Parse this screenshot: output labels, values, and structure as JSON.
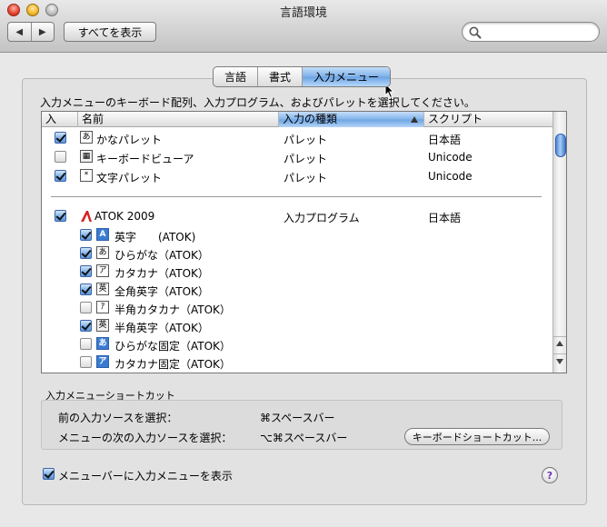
{
  "window": {
    "title": "言語環境"
  },
  "toolbar": {
    "back": "◀",
    "forward": "▶",
    "show_all": "すべてを表示",
    "search_value": "",
    "search_placeholder": ""
  },
  "tabs": [
    {
      "label": "言語",
      "active": false
    },
    {
      "label": "書式",
      "active": false
    },
    {
      "label": "入力メニュー",
      "active": true
    }
  ],
  "description": "入力メニューのキーボード配列、入力プログラム、およびパレットを選択してください。",
  "columns": {
    "enabled": "入",
    "name": "名前",
    "kind": "入力の種類",
    "script": "スクリプト",
    "sorted_column": "kind"
  },
  "rows": [
    {
      "checked": true,
      "icon_glyph": "あ",
      "icon": "kana-palette-icon",
      "name": "かなパレット",
      "kind": "パレット",
      "script": "日本語"
    },
    {
      "checked": false,
      "icon_glyph": "▦",
      "icon": "keyboard-viewer-icon",
      "name": "キーボードビューア",
      "kind": "パレット",
      "script": "Unicode"
    },
    {
      "checked": true,
      "icon_glyph": "*",
      "icon": "character-palette-icon",
      "name": "文字パレット",
      "kind": "パレット",
      "script": "Unicode"
    },
    {
      "checked": true,
      "icon_glyph": "",
      "icon": "atok-logo-icon",
      "name": "ATOK 2009",
      "kind": "入力プログラム",
      "script": "日本語"
    }
  ],
  "subrows": [
    {
      "checked": true,
      "icon_glyph": "A",
      "icon_style": "blue",
      "name": "英字　　(ATOK)"
    },
    {
      "checked": true,
      "icon_glyph": "あ",
      "icon_style": "white",
      "name": "ひらがな（ATOK）"
    },
    {
      "checked": true,
      "icon_glyph": "ア",
      "icon_style": "white",
      "name": "カタカナ（ATOK）"
    },
    {
      "checked": true,
      "icon_glyph": "英",
      "icon_style": "white",
      "name": "全角英字（ATOK）"
    },
    {
      "checked": false,
      "icon_glyph": "ｱ",
      "icon_style": "white",
      "name": "半角カタカナ（ATOK）"
    },
    {
      "checked": true,
      "icon_glyph": "英",
      "icon_style": "gray",
      "name": "半角英字（ATOK）"
    },
    {
      "checked": false,
      "icon_glyph": "あ",
      "icon_style": "blue",
      "name": "ひらがな固定（ATOK）"
    },
    {
      "checked": false,
      "icon_glyph": "ア",
      "icon_style": "blue",
      "name": "カタカナ固定（ATOK）"
    }
  ],
  "shortcuts": {
    "title": "入力メニューショートカット",
    "prev_label": "前の入力ソースを選択：",
    "prev_value": "⌘スペースバー",
    "next_label": "メニューの次の入力ソースを選択：",
    "next_value": "⌥⌘スペースバー",
    "button": "キーボードショートカット..."
  },
  "show_in_menubar": {
    "checked": true,
    "label": "メニューバーに入力メニューを表示"
  },
  "help": "?",
  "colors": {
    "accent": "#6aa3e3",
    "panel": "#e2e2e2",
    "window": "#e8e8e8"
  }
}
